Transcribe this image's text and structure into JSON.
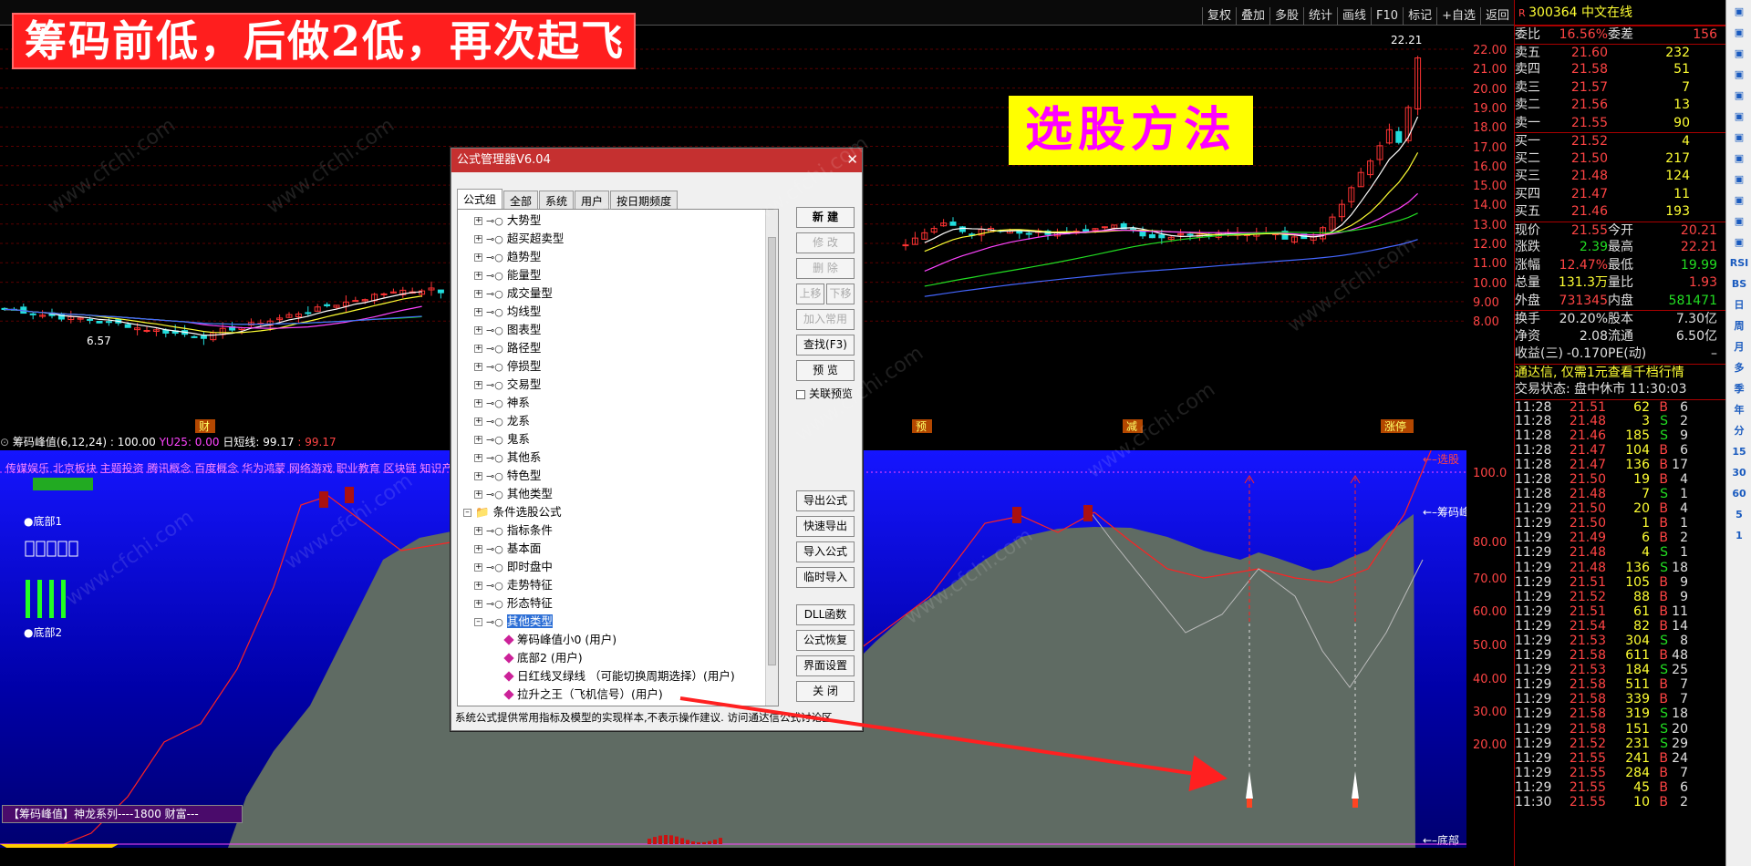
{
  "banner": "筹码前低，后做2低，再次起飞",
  "xuangu": "选股方法",
  "toolbar": [
    "复权",
    "叠加",
    "多股",
    "统计",
    "画线",
    "F10",
    "标记",
    "+自选",
    "返回"
  ],
  "price_axis": [
    "22.00",
    "21.00",
    "20.00",
    "19.00",
    "18.00",
    "17.00",
    "16.00",
    "15.00",
    "14.00",
    "13.00",
    "12.00",
    "11.00",
    "10.00",
    "9.00",
    "8.00"
  ],
  "price_high_label": "22.21",
  "price_low_label": "6.57",
  "event_marks": [
    "财",
    "预",
    "减",
    "涨停"
  ],
  "indicator": {
    "name": "筹码峰值(6,12,24)",
    "v1": ": 100.00",
    "yu": "YU25: 0.00",
    "ri": "日短线: 99.17",
    "v2": ": 99.17"
  },
  "sector_text": "传媒娱乐 北京板块 主题投资 腾讯概念 百度概念 华为鸿蒙 网络游戏 职业教育 区块链 知识产",
  "ind_axis": [
    "100.0",
    "80.00",
    "70.00",
    "60.00",
    "50.00",
    "40.00",
    "30.00",
    "20.00"
  ],
  "ind_labels": {
    "top": "选股",
    "mid": "筹码峰",
    "bottom": "底部"
  },
  "legend": {
    "b1": "底部1",
    "b2": "底部2"
  },
  "bottom_label": "【筹码峰值】神龙系列----1800 财富---",
  "stock": {
    "code": "300364",
    "name": "中文在线"
  },
  "weibi": {
    "label1": "委比",
    "v1": "16.56%",
    "label2": "委差",
    "v2": "156"
  },
  "sells": [
    {
      "n": "卖五",
      "p": "21.60",
      "v": "232"
    },
    {
      "n": "卖四",
      "p": "21.58",
      "v": "51"
    },
    {
      "n": "卖三",
      "p": "21.57",
      "v": "7"
    },
    {
      "n": "卖二",
      "p": "21.56",
      "v": "13"
    },
    {
      "n": "卖一",
      "p": "21.55",
      "v": "90"
    }
  ],
  "buys": [
    {
      "n": "买一",
      "p": "21.52",
      "v": "4"
    },
    {
      "n": "买二",
      "p": "21.50",
      "v": "217"
    },
    {
      "n": "买三",
      "p": "21.48",
      "v": "124"
    },
    {
      "n": "买四",
      "p": "21.47",
      "v": "11"
    },
    {
      "n": "买五",
      "p": "21.46",
      "v": "193"
    }
  ],
  "stats": [
    {
      "a": "现价",
      "av": "21.55",
      "b": "今开",
      "bv": "20.21"
    },
    {
      "a": "涨跌",
      "av": "2.39",
      "b": "最高",
      "bv": "22.21"
    },
    {
      "a": "涨幅",
      "av": "12.47%",
      "b": "最低",
      "bv": "19.99"
    },
    {
      "a": "总量",
      "av": "131.3万",
      "b": "量比",
      "bv": "1.93"
    },
    {
      "a": "外盘",
      "av": "731345",
      "b": "内盘",
      "bv": "581471"
    }
  ],
  "stats2": [
    {
      "a": "换手",
      "av": "20.20%",
      "b": "股本",
      "bv": "7.30亿"
    },
    {
      "a": "净资",
      "av": "2.08",
      "b": "流通",
      "bv": "6.50亿"
    },
    {
      "a": "收益(三)",
      "av": "-0.170",
      "b": "PE(动)",
      "bv": "–"
    }
  ],
  "notice": "通达信, 仅需1元查看千档行情",
  "trade_state": "交易状态: 盘中休市 11:30:03",
  "ticks": [
    [
      "11:28",
      "21.51",
      "62",
      "B",
      "6"
    ],
    [
      "11:28",
      "21.48",
      "3",
      "S",
      "2"
    ],
    [
      "11:28",
      "21.46",
      "185",
      "S",
      "9"
    ],
    [
      "11:28",
      "21.47",
      "104",
      "B",
      "6"
    ],
    [
      "11:28",
      "21.47",
      "136",
      "B",
      "17"
    ],
    [
      "11:28",
      "21.50",
      "19",
      "B",
      "4"
    ],
    [
      "11:28",
      "21.48",
      "7",
      "S",
      "1"
    ],
    [
      "11:29",
      "21.50",
      "20",
      "B",
      "4"
    ],
    [
      "11:29",
      "21.50",
      "1",
      "B",
      "1"
    ],
    [
      "11:29",
      "21.49",
      "6",
      "B",
      "2"
    ],
    [
      "11:29",
      "21.48",
      "4",
      "S",
      "1"
    ],
    [
      "11:29",
      "21.48",
      "136",
      "S",
      "18"
    ],
    [
      "11:29",
      "21.51",
      "105",
      "B",
      "9"
    ],
    [
      "11:29",
      "21.52",
      "88",
      "B",
      "9"
    ],
    [
      "11:29",
      "21.51",
      "61",
      "B",
      "11"
    ],
    [
      "11:29",
      "21.54",
      "82",
      "B",
      "14"
    ],
    [
      "11:29",
      "21.53",
      "304",
      "S",
      "8"
    ],
    [
      "11:29",
      "21.58",
      "611",
      "B",
      "48"
    ],
    [
      "11:29",
      "21.53",
      "184",
      "S",
      "25"
    ],
    [
      "11:29",
      "21.58",
      "511",
      "B",
      "7"
    ],
    [
      "11:29",
      "21.58",
      "339",
      "B",
      "7"
    ],
    [
      "11:29",
      "21.58",
      "319",
      "S",
      "18"
    ],
    [
      "11:29",
      "21.58",
      "151",
      "S",
      "20"
    ],
    [
      "11:29",
      "21.52",
      "231",
      "S",
      "29"
    ],
    [
      "11:29",
      "21.55",
      "241",
      "B",
      "24"
    ],
    [
      "11:29",
      "21.55",
      "284",
      "B",
      "7"
    ],
    [
      "11:29",
      "21.55",
      "45",
      "B",
      "6"
    ],
    [
      "11:30",
      "21.55",
      "10",
      "B",
      "2"
    ]
  ],
  "side_icons": [
    "RSI",
    "BS",
    "日",
    "周",
    "月",
    "多",
    "季",
    "年",
    "分",
    "15",
    "30",
    "60",
    "5",
    "1"
  ],
  "dialog": {
    "title": "公式管理器V6.04",
    "tabs": [
      "公式组",
      "全部",
      "系统",
      "用户",
      "按日期频度"
    ],
    "tree": [
      "大势型",
      "超买超卖型",
      "趋势型",
      "能量型",
      "成交量型",
      "均线型",
      "图表型",
      "路径型",
      "停损型",
      "交易型",
      "神系",
      "龙系",
      "鬼系",
      "其他系",
      "特色型",
      "其他类型"
    ],
    "folder": "条件选股公式",
    "sub": [
      "指标条件",
      "基本面",
      "即时盘中",
      "走势特征",
      "形态特征",
      "其他类型"
    ],
    "leaves": [
      "筹码峰值小0  (用户)",
      "底部2  (用户)",
      "日红线叉绿线 （可能切换周期选择）(用户)",
      "拉升之王（飞机信号）(用户)"
    ],
    "buttons1": [
      "新 建",
      "修 改",
      "删 除",
      "上移",
      "下移",
      "加入常用",
      "查找(F3)",
      "预 览"
    ],
    "checkbox": "关联预览",
    "buttons2": [
      "导出公式",
      "快速导出",
      "导入公式",
      "临时导入",
      "DLL函数",
      "公式恢复",
      "界面设置",
      "关 闭"
    ],
    "footer": "系统公式提供常用指标及模型的实现样本,不表示操作建议.   访问通达信公式讨论区"
  },
  "watermark": "www.cfchi.com"
}
